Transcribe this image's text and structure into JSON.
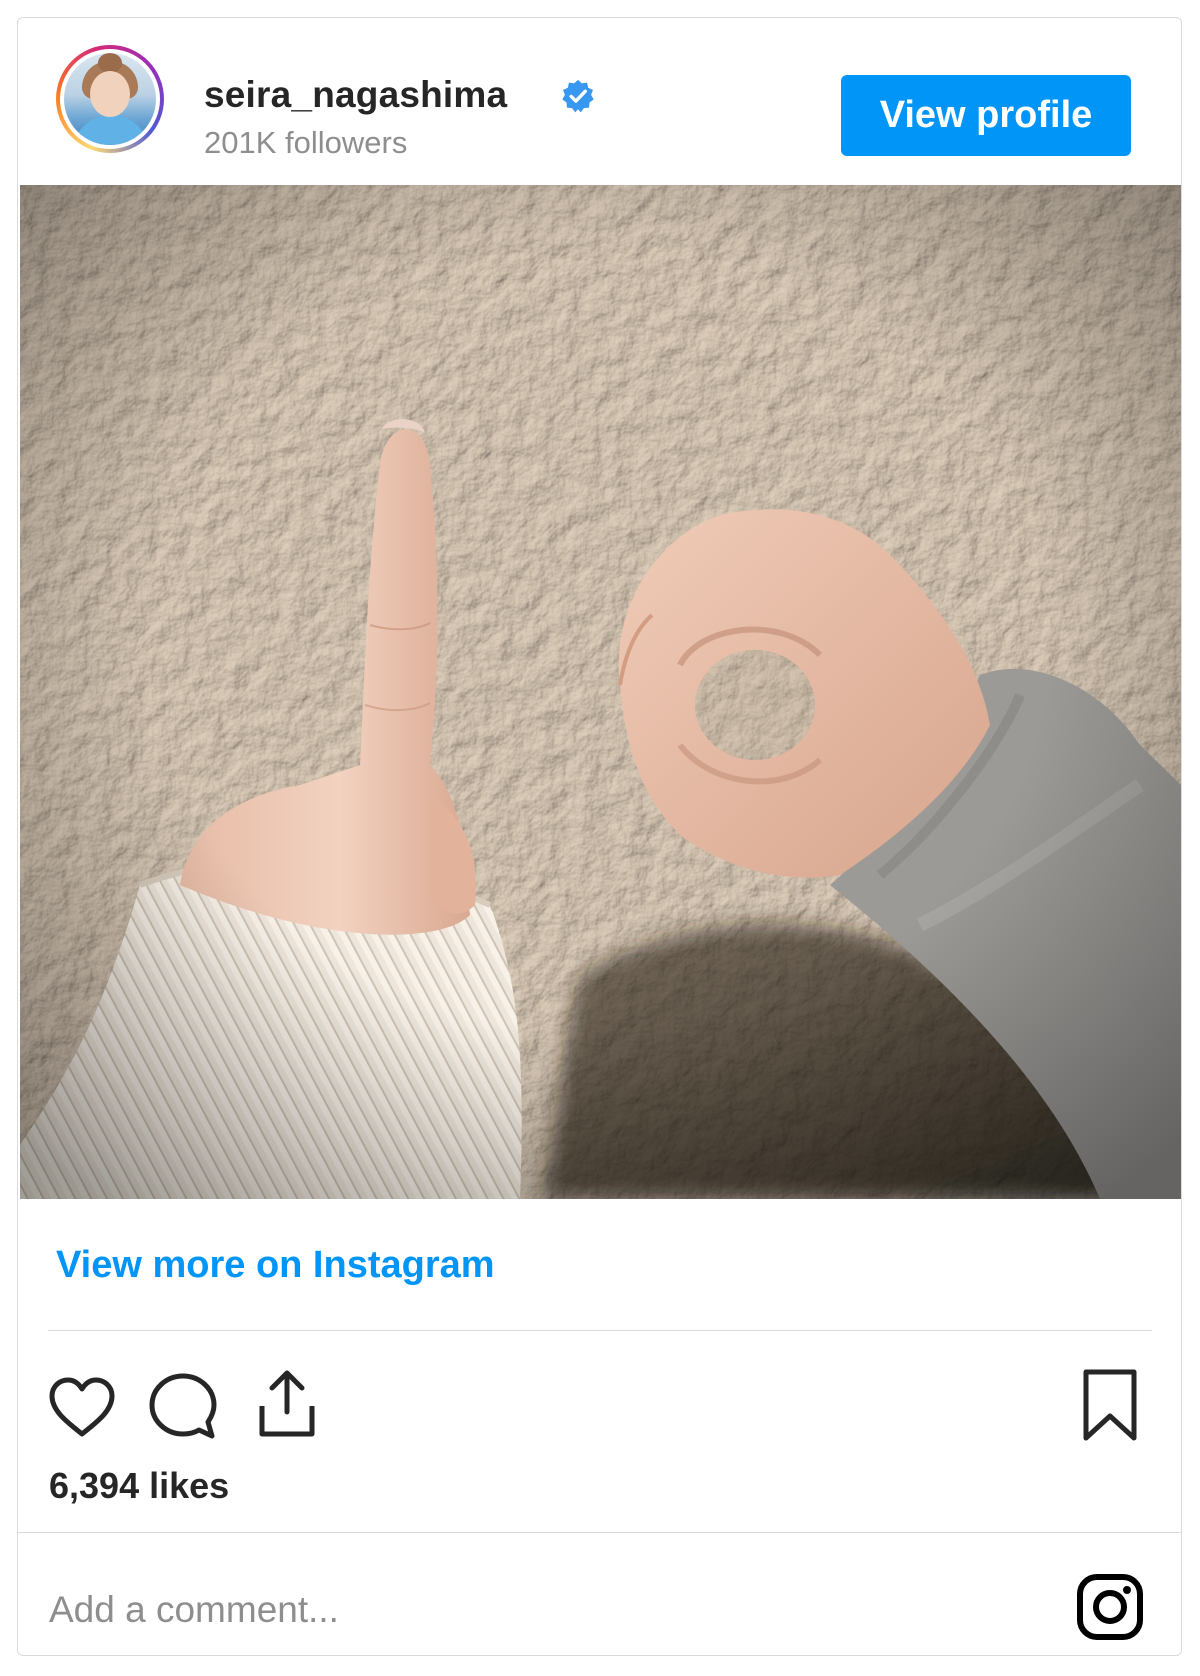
{
  "profile": {
    "username": "seira_nagashima",
    "followers": "201K followers",
    "view_profile_label": "View profile"
  },
  "post": {
    "view_more_label": "View more on Instagram",
    "likes": "6,394 likes",
    "comment_placeholder": "Add a comment..."
  },
  "colors": {
    "accent": "#0095f6",
    "text": "#262626",
    "muted": "#8e8e8e",
    "border": "#dbdbdb"
  },
  "icons": {
    "verified": "verified-badge-icon",
    "like": "heart-icon",
    "comment": "comment-bubble-icon",
    "share": "share-icon",
    "save": "bookmark-icon",
    "brand": "instagram-logo-icon"
  }
}
